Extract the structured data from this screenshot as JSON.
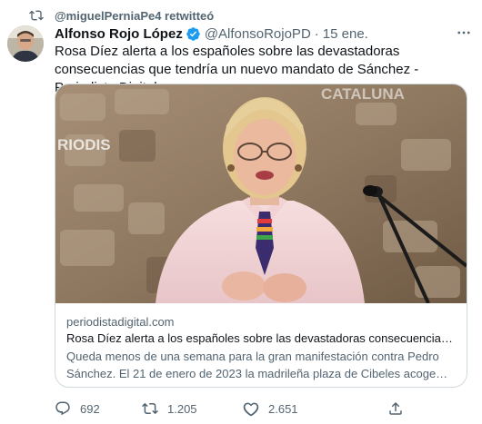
{
  "retweet": {
    "text": "@miguelPerniaPe4 retwitteó",
    "icon": "retweet-icon"
  },
  "author": {
    "name": "Alfonso Rojo López",
    "handle": "@AlfonsoRojoPD",
    "separator": "·",
    "date": "15 ene.",
    "verified_icon": "verified-badge-icon",
    "more_icon": "more-options-icon"
  },
  "tweet": {
    "text": "Rosa Díez alerta a los españoles sobre las devastadoras consecuencias que tendría un nuevo mandato de Sánchez - Periodista Digital"
  },
  "card": {
    "image_watermark": "CATALUNA",
    "image_watermark_left": "RIODIS",
    "domain": "periodistadigital.com",
    "title": "Rosa Díez alerta a los españoles sobre las devastadoras consecuencias que tendría un nuevo mandato de Sánchez",
    "description": "Queda menos de una semana para la gran manifestación contra Pedro Sánchez. El 21 de enero de 2023 la madrileña plaza de Cibeles acoge una multitudinaria protesta"
  },
  "actions": {
    "reply": {
      "icon": "reply-icon",
      "count": "692"
    },
    "retweet": {
      "icon": "retweet-icon",
      "count": "1.205"
    },
    "like": {
      "icon": "heart-icon",
      "count": "2.651"
    },
    "share": {
      "icon": "share-icon"
    }
  },
  "colors": {
    "text_primary": "#0f1419",
    "text_secondary": "#536471",
    "verified_blue": "#1d9bf0",
    "border": "#cfd9de"
  }
}
